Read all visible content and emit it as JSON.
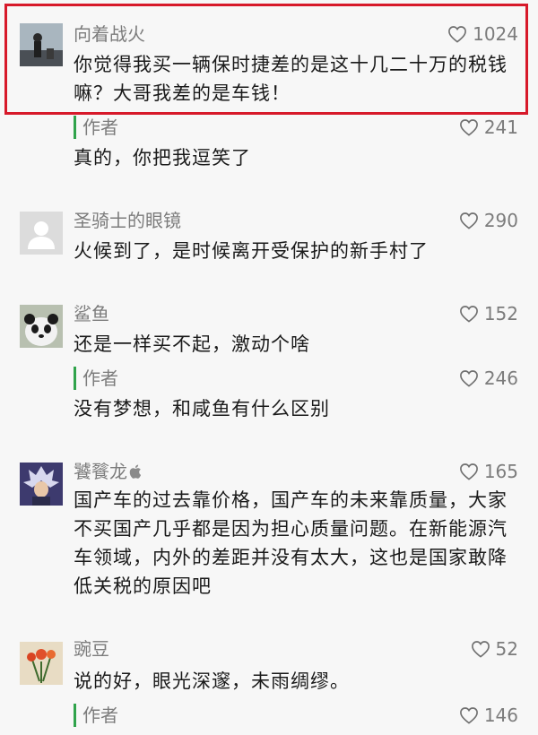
{
  "comments": [
    {
      "user": "向着战火",
      "likes": "1024",
      "text": "你觉得我买一辆保时捷差的是这十几二十万的税钱嘛？大哥我差的是车钱！",
      "author_reply": {
        "label": "作者",
        "likes": "241",
        "text": "真的，你把我逗笑了"
      }
    },
    {
      "user": "圣骑士的眼镜",
      "likes": "290",
      "text": "火候到了，是时候离开受保护的新手村了"
    },
    {
      "user": "鲨鱼",
      "likes": "152",
      "text": "还是一样买不起，激动个啥",
      "author_reply": {
        "label": "作者",
        "likes": "246",
        "text": "没有梦想，和咸鱼有什么区别"
      }
    },
    {
      "user": "饕餮龙",
      "user_badge": "apple-icon",
      "likes": "165",
      "text": "国产车的过去靠价格，国产车的未来靠质量，大家不买国产几乎都是因为担心质量问题。在新能源汽车领域，内外的差距并没有太大，这也是国家敢降低关税的原因吧"
    },
    {
      "user": "豌豆",
      "likes": "52",
      "text": "说的好，眼光深邃，未雨绸缪。",
      "author_reply": {
        "label": "作者",
        "likes": "146",
        "text": ""
      }
    }
  ],
  "highlight_color": "#d7192a",
  "reply_bar_color": "#30a34b"
}
